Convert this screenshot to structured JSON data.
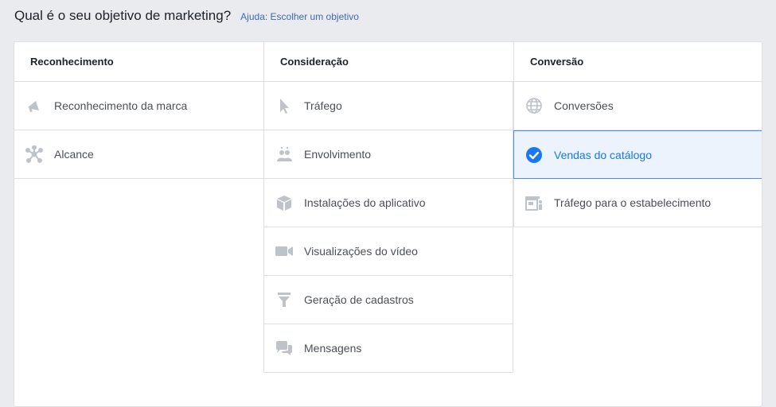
{
  "header": {
    "title": "Qual é o seu objetivo de marketing?",
    "help_link": "Ajuda: Escolher um objetivo"
  },
  "columns": [
    {
      "title": "Reconhecimento",
      "items": [
        {
          "label": "Reconhecimento da marca",
          "icon": "megaphone-icon"
        },
        {
          "label": "Alcance",
          "icon": "reach-icon"
        }
      ]
    },
    {
      "title": "Consideração",
      "items": [
        {
          "label": "Tráfego",
          "icon": "cursor-icon"
        },
        {
          "label": "Envolvimento",
          "icon": "people-icon"
        },
        {
          "label": "Instalações do aplicativo",
          "icon": "box-icon"
        },
        {
          "label": "Visualizações do vídeo",
          "icon": "video-camera-icon"
        },
        {
          "label": "Geração de cadastros",
          "icon": "funnel-icon"
        },
        {
          "label": "Mensagens",
          "icon": "chat-bubbles-icon"
        }
      ]
    },
    {
      "title": "Conversão",
      "items": [
        {
          "label": "Conversões",
          "icon": "globe-icon"
        },
        {
          "label": "Vendas do catálogo",
          "icon": "check-circle-icon",
          "selected": true
        },
        {
          "label": "Tráfego para o estabelecimento",
          "icon": "store-icon"
        }
      ]
    }
  ],
  "colors": {
    "background": "#e9ebee",
    "icon_gray": "#bec3c9",
    "selected_blue": "#1877f2",
    "selected_bg": "#ecf3fd",
    "link": "#4267b2"
  }
}
